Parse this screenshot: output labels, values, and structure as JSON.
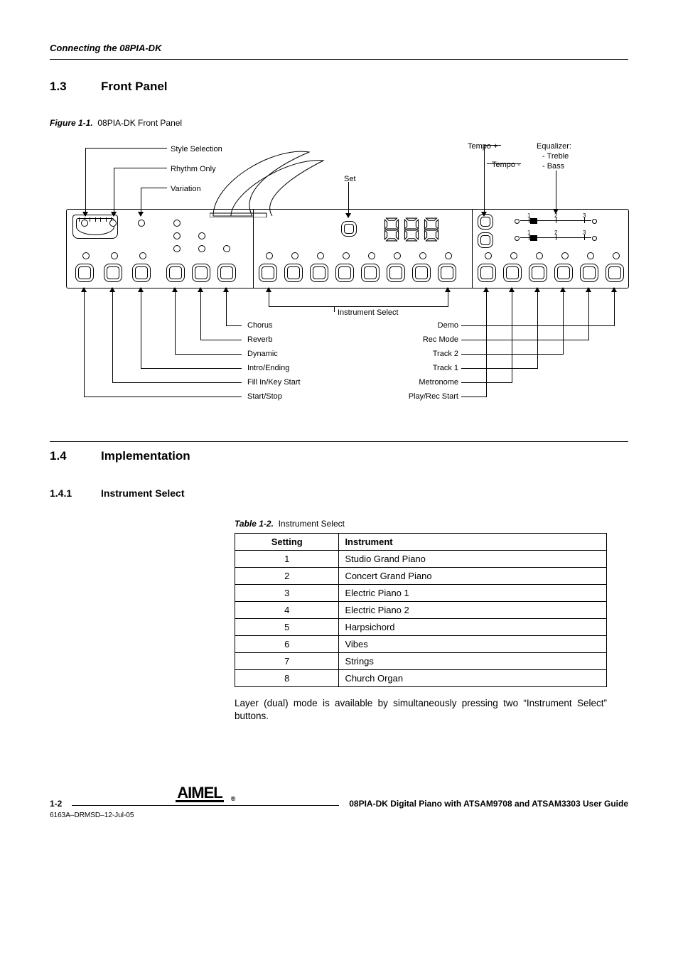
{
  "running_head": "Connecting the 08PIA-DK",
  "sections": {
    "s1": {
      "num": "1.3",
      "title": "Front Panel"
    },
    "s2": {
      "num": "1.4",
      "title": "Implementation"
    },
    "s21": {
      "num": "1.4.1",
      "title": "Instrument Select"
    }
  },
  "figure": {
    "lead": "Figure 1-1.",
    "title": "08PIA-DK Front Panel",
    "labels": {
      "style_selection": "Style Selection",
      "rhythm_only": "Rhythm Only",
      "variation": "Variation",
      "set": "Set",
      "tempo_plus": "Tempo +",
      "tempo_minus": "Tempo -",
      "equalizer": "Equalizer:",
      "eq_treble": "- Treble",
      "eq_bass": "- Bass",
      "instrument_select": "Instrument Select",
      "chorus": "Chorus",
      "reverb": "Reverb",
      "dynamic": "Dynamic",
      "intro_ending": "Intro/Ending",
      "fill_key": "Fill In/Key Start",
      "start_stop": "Start/Stop",
      "demo": "Demo",
      "rec_mode": "Rec Mode",
      "track2": "Track 2",
      "track1": "Track 1",
      "metronome": "Metronome",
      "play_rec": "Play/Rec Start"
    }
  },
  "table": {
    "lead": "Table 1-2.",
    "title": "Instrument Select",
    "headers": {
      "a": "Setting",
      "b": "Instrument"
    },
    "rows": [
      {
        "a": "1",
        "b": "Studio Grand Piano"
      },
      {
        "a": "2",
        "b": "Concert Grand Piano"
      },
      {
        "a": "3",
        "b": "Electric Piano 1"
      },
      {
        "a": "4",
        "b": "Electric Piano 2"
      },
      {
        "a": "5",
        "b": "Harpsichord"
      },
      {
        "a": "6",
        "b": "Vibes"
      },
      {
        "a": "7",
        "b": "Strings"
      },
      {
        "a": "8",
        "b": "Church Organ"
      }
    ]
  },
  "paragraph": "Layer (dual) mode is available by simultaneously pressing two “Instrument Select” buttons.",
  "footer": {
    "page": "1-2",
    "logo": "AIMEL",
    "title": "08PIA-DK Digital Piano with ATSAM9708 and ATSAM3303 User Guide",
    "docid": "6163A–DRMSD–12-Jul-05"
  },
  "slider_ticks": {
    "a": "1",
    "b": "2",
    "c": "3"
  }
}
